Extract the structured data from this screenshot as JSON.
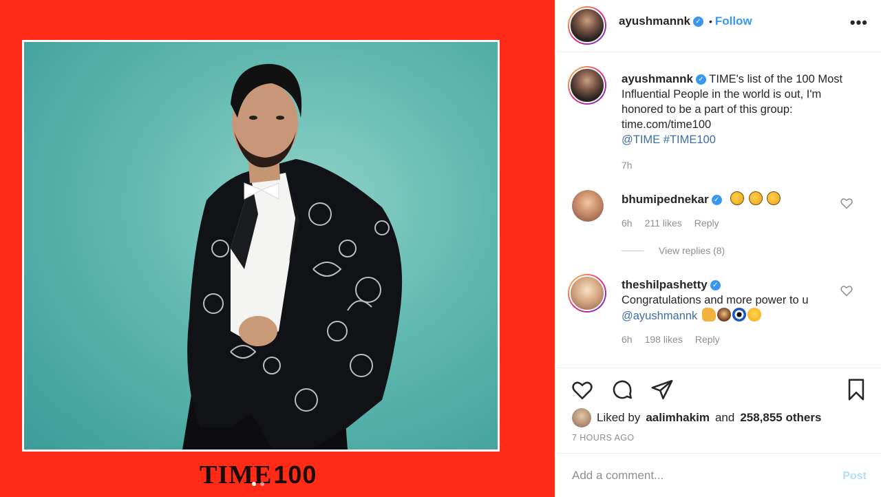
{
  "media": {
    "logo_time": "TIME",
    "logo_number": "100",
    "carousel_total": 2,
    "carousel_active": 1
  },
  "header": {
    "username": "ayushmannk",
    "separator": "•",
    "follow_label": "Follow",
    "more_label": "•••"
  },
  "caption": {
    "username": "ayushmannk",
    "text": "TIME's list of the 100 Most Influential People in the world is out, I'm honored to be a part of this group: time.com/time100",
    "mention": "@TIME",
    "hashtag": "#TIME100",
    "time": "7h"
  },
  "comments": [
    {
      "username": "bhumipednekar",
      "emojis": [
        "clap",
        "clap",
        "clap"
      ],
      "time": "6h",
      "likes": "211 likes",
      "reply_label": "Reply",
      "view_replies": "View replies (8)"
    },
    {
      "username": "theshilpashetty",
      "text": "Congratulations and more power to u",
      "mention": "@ayushmannk",
      "emojis": [
        "muscle",
        "bow",
        "eye",
        "smile"
      ],
      "time": "6h",
      "likes": "198 likes",
      "reply_label": "Reply"
    }
  ],
  "actions": {
    "icons": [
      "heart-icon",
      "comment-icon",
      "share-icon",
      "bookmark-icon"
    ],
    "liked_prefix": "Liked by",
    "liked_user": "aalimhakim",
    "liked_and": "and",
    "liked_others": "258,855 others",
    "ago": "7 HOURS AGO"
  },
  "add_comment": {
    "placeholder": "Add a comment...",
    "post_label": "Post"
  },
  "colors": {
    "background_red": "#ff2b16",
    "link_blue": "#3897f0",
    "muted": "#8e8e8e"
  }
}
